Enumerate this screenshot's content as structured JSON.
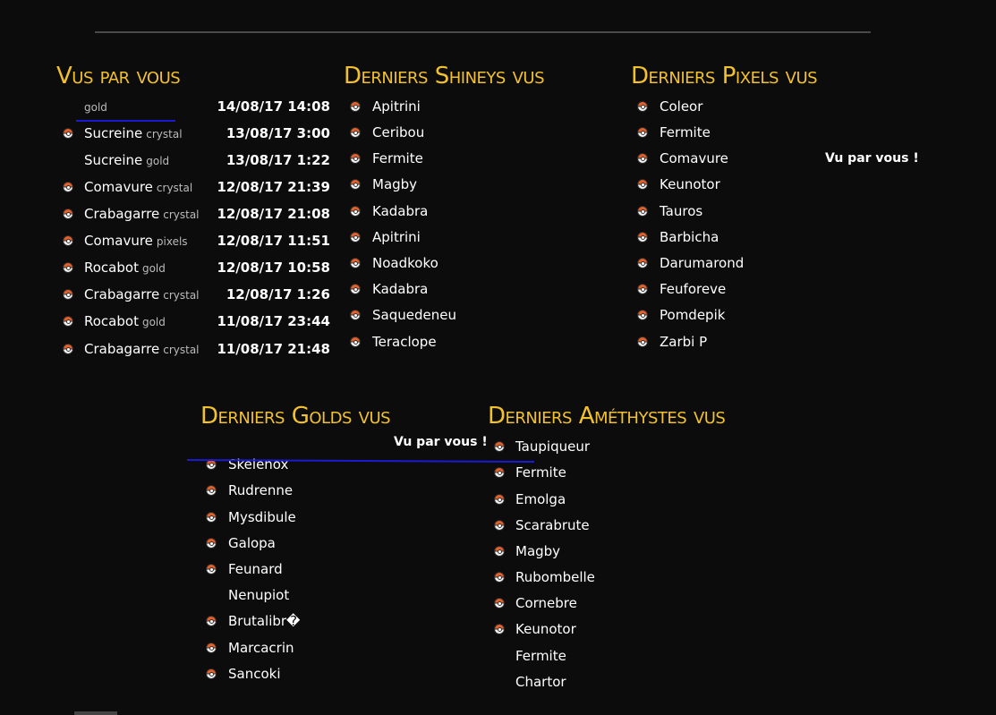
{
  "vus_par_vous": {
    "title": "Vus par vous",
    "entries": [
      {
        "name": "",
        "version": "gold",
        "timestamp": "14/08/17 14:08",
        "icon": false
      },
      {
        "name": "Sucreine",
        "version": "crystal",
        "timestamp": "13/08/17 3:00",
        "icon": true
      },
      {
        "name": "Sucreine",
        "version": "gold",
        "timestamp": "13/08/17 1:22",
        "icon": false
      },
      {
        "name": "Comavure",
        "version": "crystal",
        "timestamp": "12/08/17 21:39",
        "icon": true
      },
      {
        "name": "Crabagarre",
        "version": "crystal",
        "timestamp": "12/08/17 21:08",
        "icon": true
      },
      {
        "name": "Comavure",
        "version": "pixels",
        "timestamp": "12/08/17 11:51",
        "icon": true
      },
      {
        "name": "Rocabot",
        "version": "gold",
        "timestamp": "12/08/17 10:58",
        "icon": true
      },
      {
        "name": "Crabagarre",
        "version": "crystal",
        "timestamp": "12/08/17 1:26",
        "icon": true
      },
      {
        "name": "Rocabot",
        "version": "gold",
        "timestamp": "11/08/17 23:44",
        "icon": true
      },
      {
        "name": "Crabagarre",
        "version": "crystal",
        "timestamp": "11/08/17 21:48",
        "icon": true
      }
    ]
  },
  "shineys": {
    "title": "Derniers Shineys vus",
    "items": [
      {
        "name": "Apitrini",
        "icon": true
      },
      {
        "name": "Ceribou",
        "icon": true
      },
      {
        "name": "Fermite",
        "icon": true
      },
      {
        "name": "Magby",
        "icon": true
      },
      {
        "name": "Kadabra",
        "icon": true
      },
      {
        "name": "Apitrini",
        "icon": true
      },
      {
        "name": "Noadkoko",
        "icon": true
      },
      {
        "name": "Kadabra",
        "icon": true
      },
      {
        "name": "Saquedeneu",
        "icon": true
      },
      {
        "name": "Teraclope",
        "icon": true
      }
    ]
  },
  "pixels": {
    "title": "Derniers Pixels vus",
    "vu_label": "Vu par vous !",
    "items": [
      {
        "name": "Coleor",
        "icon": true
      },
      {
        "name": "Fermite",
        "icon": true
      },
      {
        "name": "Comavure",
        "icon": true
      },
      {
        "name": "Keunotor",
        "icon": true
      },
      {
        "name": "Tauros",
        "icon": true
      },
      {
        "name": "Barbicha",
        "icon": true
      },
      {
        "name": "Darumarond",
        "icon": true
      },
      {
        "name": "Feuforeve",
        "icon": true
      },
      {
        "name": "Pomdepik",
        "icon": true
      },
      {
        "name": "Zarbi P",
        "icon": true
      }
    ]
  },
  "golds": {
    "title": "Derniers Golds vus",
    "vu_label": "Vu par vous !",
    "items": [
      {
        "name": "Skelenox",
        "icon": true
      },
      {
        "name": "Rudrenne",
        "icon": true
      },
      {
        "name": "Mysdibule",
        "icon": true
      },
      {
        "name": "Galopa",
        "icon": true
      },
      {
        "name": "Feunard",
        "icon": true
      },
      {
        "name": "Nenupiot",
        "icon": false
      },
      {
        "name": "Brutalibr�",
        "icon": true
      },
      {
        "name": "Marcacrin",
        "icon": true
      },
      {
        "name": "Sancoki",
        "icon": true
      }
    ]
  },
  "amethystes": {
    "title": "Derniers Améthystes vus",
    "items": [
      {
        "name": "Taupiqueur",
        "icon": true
      },
      {
        "name": "Fermite",
        "icon": true
      },
      {
        "name": "Emolga",
        "icon": true
      },
      {
        "name": "Scarabrute",
        "icon": true
      },
      {
        "name": "Magby",
        "icon": true
      },
      {
        "name": "Rubombelle",
        "icon": true
      },
      {
        "name": "Cornebre",
        "icon": true
      },
      {
        "name": "Keunotor",
        "icon": true
      },
      {
        "name": "Fermite",
        "icon": false
      },
      {
        "name": "Chartor",
        "icon": false
      }
    ]
  },
  "colors": {
    "accent": "#f2c12e",
    "background": "#0c0c0c",
    "annotation": "#1b1bd6"
  }
}
